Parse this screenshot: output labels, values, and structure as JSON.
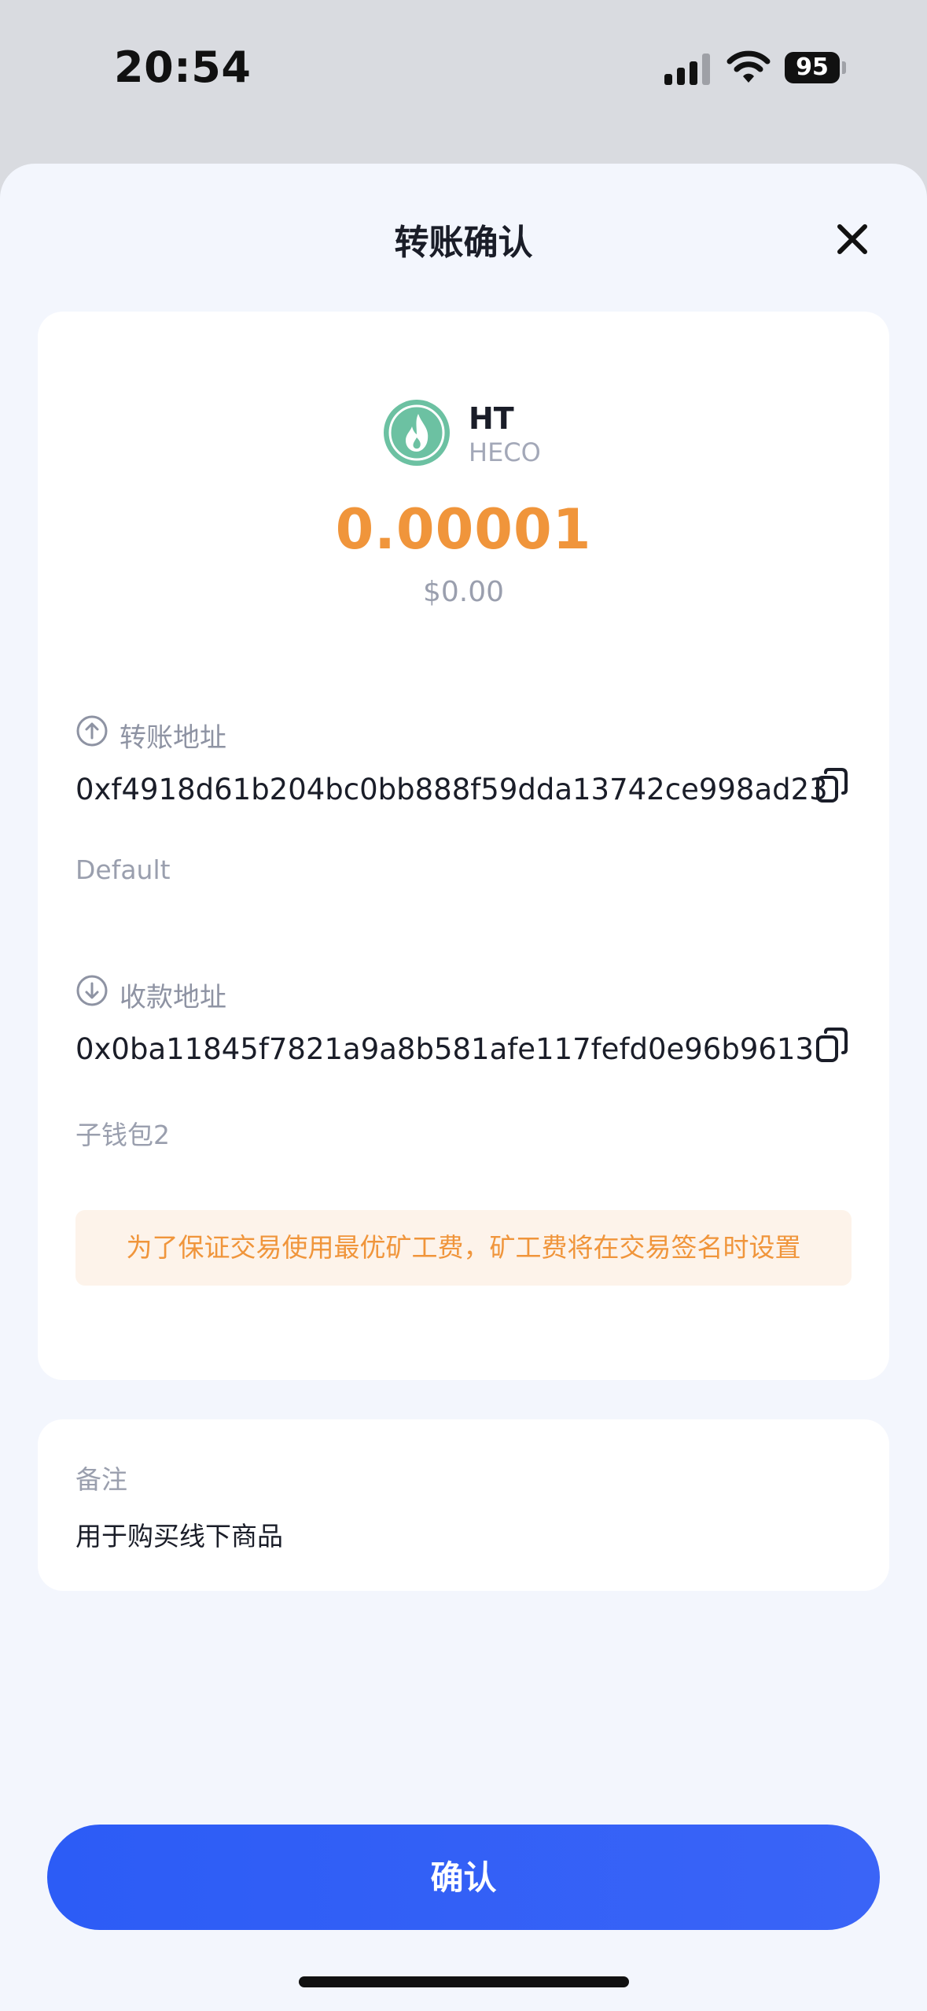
{
  "status_bar": {
    "time": "20:54",
    "battery": "95"
  },
  "sheet": {
    "title": "转账确认"
  },
  "token": {
    "symbol": "HT",
    "chain": "HECO",
    "amount": "0.00001",
    "fiat_value": "$0.00",
    "icon": "heco-flame-icon",
    "icon_color": "#6cc1a2"
  },
  "from": {
    "label": "转账地址",
    "address": "0xf4918d61b204bc0bb888f59dda13742ce998ad23",
    "wallet_name": "Default"
  },
  "to": {
    "label": "收款地址",
    "address": "0x0ba11845f7821a9a8b581afe117fefd0e96b9613",
    "wallet_name": "子钱包2"
  },
  "notice": {
    "text": "为了保证交易使用最优矿工费，矿工费将在交易签名时设置"
  },
  "note": {
    "label": "备注",
    "value": "用于购买线下商品"
  },
  "actions": {
    "confirm_label": "确认"
  },
  "colors": {
    "accent_blue": "#2c5cf6",
    "amount_orange": "#f0953b",
    "sheet_background": "#f3f6fd"
  }
}
